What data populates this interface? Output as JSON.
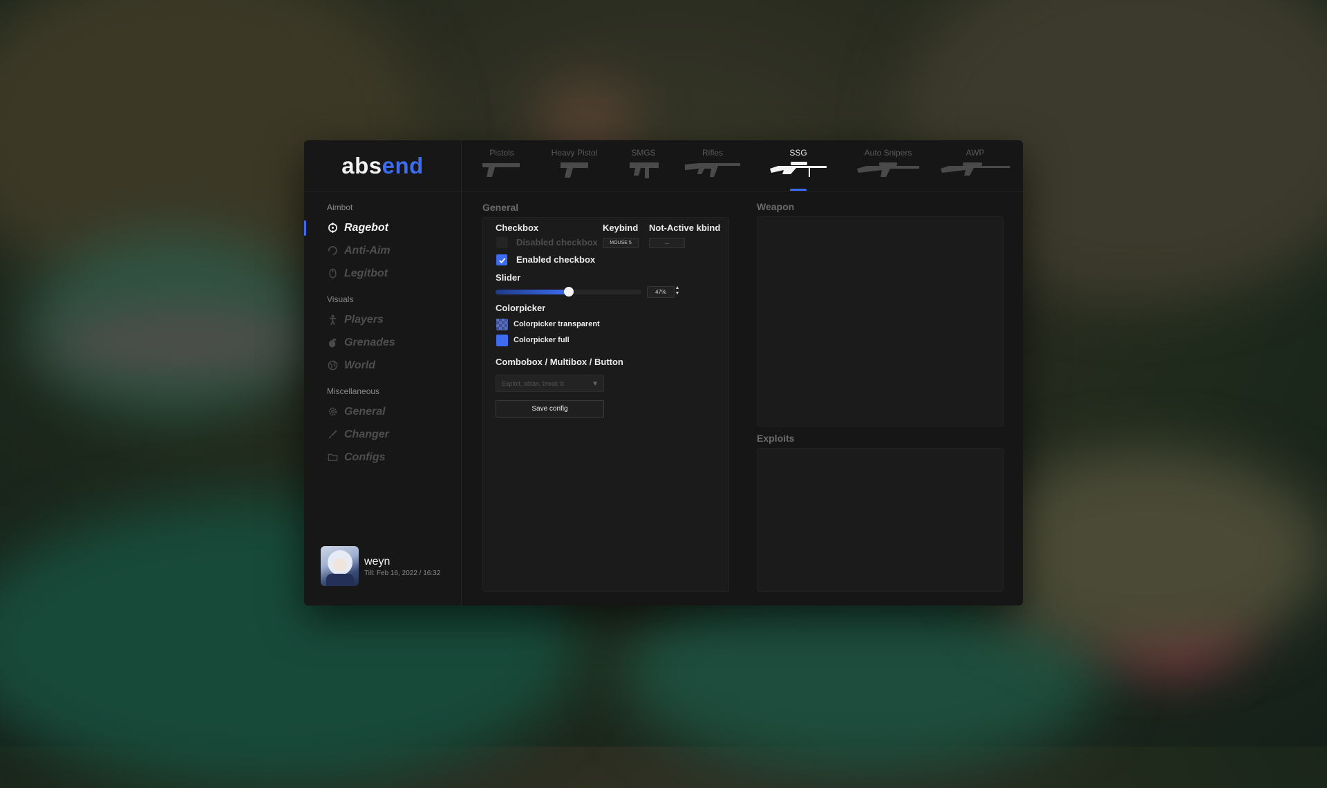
{
  "app": {
    "logo_part1": "abs",
    "logo_part2": "end",
    "accent_color": "#3d6cf2"
  },
  "tabs": [
    {
      "label": "Pistols",
      "icon": "pistol-icon"
    },
    {
      "label": "Heavy Pistol",
      "icon": "heavy-pistol-icon"
    },
    {
      "label": "SMGS",
      "icon": "smg-icon"
    },
    {
      "label": "Rifles",
      "icon": "rifle-icon"
    },
    {
      "label": "SSG",
      "icon": "ssg-icon",
      "active": true
    },
    {
      "label": "Auto Snipers",
      "icon": "auto-sniper-icon"
    },
    {
      "label": "AWP",
      "icon": "awp-icon"
    }
  ],
  "sidebar": {
    "sections": [
      {
        "title": "Aimbot",
        "items": [
          {
            "label": "Ragebot",
            "icon": "crosshair-icon",
            "active": true
          },
          {
            "label": "Anti-Aim",
            "icon": "spin-icon"
          },
          {
            "label": "Legitbot",
            "icon": "mouse-icon"
          }
        ]
      },
      {
        "title": "Visuals",
        "items": [
          {
            "label": "Players",
            "icon": "person-icon"
          },
          {
            "label": "Grenades",
            "icon": "grenade-icon"
          },
          {
            "label": "World",
            "icon": "globe-icon"
          }
        ]
      },
      {
        "title": "Miscellaneous",
        "items": [
          {
            "label": "General",
            "icon": "gear-icon"
          },
          {
            "label": "Changer",
            "icon": "brush-icon"
          },
          {
            "label": "Configs",
            "icon": "folder-icon"
          }
        ]
      }
    ]
  },
  "profile": {
    "name": "weyn",
    "subscription": "Till: Feb 16, 2022 / 16:32"
  },
  "general": {
    "title": "General",
    "checkbox_header": "Checkbox",
    "keybind_header": "Keybind",
    "notactive_header": "Not-Active kbind",
    "disabled_checkbox": {
      "label": "Disabled checkbox",
      "checked": false
    },
    "keybind_value": "MOUSE 5",
    "notactive_value": "...",
    "enabled_checkbox": {
      "label": "Enabled checkbox",
      "checked": true
    },
    "slider_label": "Slider",
    "slider_value": 47,
    "slider_text": "47%",
    "colorpicker_label": "Colorpicker",
    "colorpicker_transparent": {
      "label": "Colorpicker transparent",
      "color": "#3d6cf2"
    },
    "colorpicker_full": {
      "label": "Colorpicker full",
      "color": "#3d6cf2"
    },
    "combo_section_label": "Combobox / Multibox / Button",
    "combo_placeholder": "Exploit, eblan, break lc",
    "save_button": "Save config"
  },
  "weapon": {
    "title": "Weapon"
  },
  "exploits": {
    "title": "Exploits"
  }
}
